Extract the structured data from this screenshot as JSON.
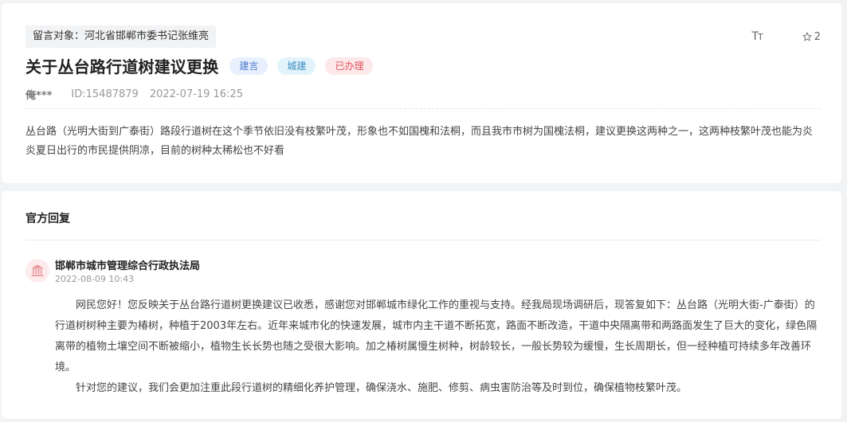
{
  "message": {
    "target_label": "留言对象：河北省邯郸市委书记张维亮",
    "title": "关于丛台路行道树建议更换",
    "tags": [
      {
        "label": "建言",
        "color": "#4a7bd0"
      },
      {
        "label": "城建",
        "color": "#3a8ec4"
      },
      {
        "label": "已办理",
        "color": "#e2545f"
      }
    ],
    "author": "俺***",
    "id_text": "ID:15487879",
    "datetime": "2022-07-19 16:25",
    "content": "丛台路（光明大街到广泰街）路段行道树在这个季节依旧没有枝繁叶茂，形象也不如国槐和法桐，而且我市市树为国槐法桐，建议更换这两种之一，这两种枝繁叶茂也能为炎炎夏日出行的市民提供阴凉，目前的树种太稀松也不好看"
  },
  "toolbar": {
    "font_icon": "font-size-icon",
    "star_icon": "star-icon",
    "star_count": "2"
  },
  "reply": {
    "section_title": "官方回复",
    "dept_icon": "government-building-icon",
    "dept_name": "邯郸市城市管理综合行政执法局",
    "reply_time": "2022-08-09 10:43",
    "paragraphs": [
      "网民您好！您反映关于丛台路行道树更换建议已收悉，感谢您对邯郸城市绿化工作的重视与支持。经我局现场调研后，现答复如下：丛台路（光明大街-广泰街）的行道树树种主要为椿树，种植于2003年左右。近年来城市化的快速发展，城市内主干道不断拓宽，路面不断改造，干道中央隔离带和两路面发生了巨大的变化，绿色隔离带的植物土壤空间不断被缩小，植物生长长势也随之受很大影响。加之椿树属慢生树种，树龄较长，一般长势较为缓慢，生长周期长，但一经种植可持续多年改善环境。",
      "针对您的建议，我们会更加注重此段行道树的精细化养护管理，确保浇水、施肥、修剪、病虫害防治等及时到位，确保植物枝繁叶茂。"
    ]
  },
  "colors": {
    "background": "#f2f3f5",
    "card": "#ffffff",
    "accent_red": "#e2545f"
  }
}
